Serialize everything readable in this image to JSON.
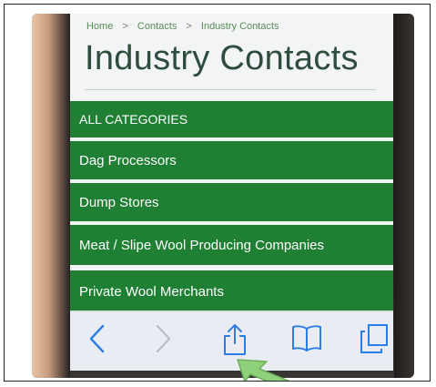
{
  "breadcrumb": {
    "items": [
      "Home",
      "Contacts",
      "Industry Contacts"
    ],
    "separator": ">"
  },
  "page": {
    "title": "Industry Contacts"
  },
  "categories": [
    "ALL CATEGORIES",
    "Dag Processors",
    "Dump Stores",
    "Meat / Slipe Wool Producing Companies",
    "Private Wool Merchants"
  ],
  "toolbar": {
    "icons": [
      "back-icon",
      "forward-icon",
      "share-icon",
      "bookmarks-icon",
      "tabs-icon"
    ],
    "accent_color": "#2a7ee6"
  },
  "theme": {
    "category_bg": "#1f7f33",
    "title_color": "#2f4d3d",
    "arrow_color": "#8fd07a"
  }
}
